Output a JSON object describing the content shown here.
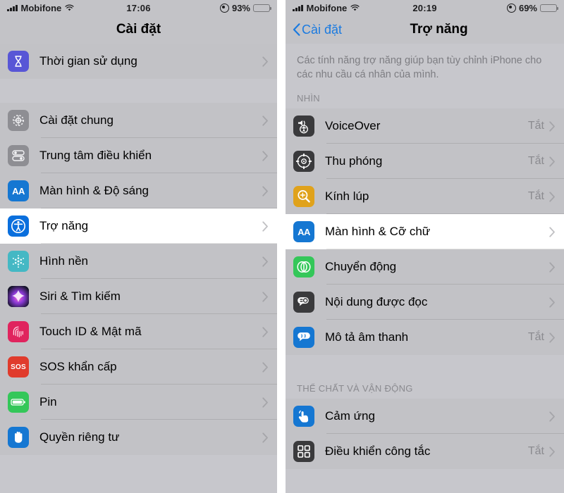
{
  "left_phone": {
    "status_bar": {
      "carrier": "Mobifone",
      "time": "17:06",
      "battery_pct": "93%",
      "battery_level": 93
    },
    "nav": {
      "title": "Cài đặt"
    },
    "groups": [
      {
        "rows": [
          {
            "label": "Thời gian sử dụng",
            "value": "",
            "icon": "hourglass-icon",
            "icon_color": "#5856d6",
            "selected": false
          }
        ]
      },
      {
        "rows": [
          {
            "label": "Cài đặt chung",
            "value": "",
            "icon": "gear-icon",
            "icon_color": "#8e8e93",
            "selected": false
          },
          {
            "label": "Trung tâm điều khiển",
            "value": "",
            "icon": "control-center-icon",
            "icon_color": "#8e8e93",
            "selected": false
          },
          {
            "label": "Màn hình & Độ sáng",
            "value": "",
            "icon": "display-brightness-icon",
            "icon_color": "#1577d2",
            "selected": false
          },
          {
            "label": "Trợ năng",
            "value": "",
            "icon": "accessibility-icon",
            "icon_color": "#0a6fdd",
            "selected": true
          },
          {
            "label": "Hình nền",
            "value": "",
            "icon": "wallpaper-icon",
            "icon_color": "#44b8c4",
            "selected": false
          },
          {
            "label": "Siri & Tìm kiếm",
            "value": "",
            "icon": "siri-icon",
            "icon_color": "#1c1c2e",
            "selected": false
          },
          {
            "label": "Touch ID & Mật mã",
            "value": "",
            "icon": "fingerprint-icon",
            "icon_color": "#e0245e",
            "selected": false
          },
          {
            "label": "SOS khẩn cấp",
            "value": "",
            "icon": "sos-icon",
            "icon_color": "#e03b2c",
            "selected": false
          },
          {
            "label": "Pin",
            "value": "",
            "icon": "battery-icon",
            "icon_color": "#34c759",
            "selected": false
          },
          {
            "label": "Quyền riêng tư",
            "value": "",
            "icon": "privacy-hand-icon",
            "icon_color": "#1577d2",
            "selected": false
          }
        ]
      }
    ]
  },
  "right_phone": {
    "status_bar": {
      "carrier": "Mobifone",
      "time": "20:19",
      "battery_pct": "69%",
      "battery_level": 69
    },
    "nav": {
      "back_label": "Cài đặt",
      "title": "Trợ năng"
    },
    "description": "Các tính năng trợ năng giúp bạn tùy chỉnh iPhone cho các nhu cầu cá nhân của mình.",
    "sections": [
      {
        "header": "NHÌN",
        "rows": [
          {
            "label": "VoiceOver",
            "value": "Tắt",
            "icon": "voiceover-icon",
            "icon_color": "#3a3a3c",
            "selected": false
          },
          {
            "label": "Thu phóng",
            "value": "Tắt",
            "icon": "zoom-icon",
            "icon_color": "#3a3a3c",
            "selected": false
          },
          {
            "label": "Kính lúp",
            "value": "Tắt",
            "icon": "magnifier-icon",
            "icon_color": "#e0a21b",
            "selected": false
          },
          {
            "label": "Màn hình & Cỡ chữ",
            "value": "",
            "icon": "display-text-size-icon",
            "icon_color": "#1577d2",
            "selected": true
          },
          {
            "label": "Chuyển động",
            "value": "",
            "icon": "motion-icon",
            "icon_color": "#34c759",
            "selected": false
          },
          {
            "label": "Nội dung được đọc",
            "value": "",
            "icon": "spoken-content-icon",
            "icon_color": "#3a3a3c",
            "selected": false
          },
          {
            "label": "Mô tả âm thanh",
            "value": "Tắt",
            "icon": "audio-description-icon",
            "icon_color": "#1577d2",
            "selected": false
          }
        ]
      },
      {
        "header": "THỂ CHẤT VÀ VẬN ĐỘNG",
        "rows": [
          {
            "label": "Cảm ứng",
            "value": "",
            "icon": "touch-icon",
            "icon_color": "#1577d2",
            "selected": false
          },
          {
            "label": "Điều khiển công tắc",
            "value": "Tắt",
            "icon": "switch-control-icon",
            "icon_color": "#3a3a3c",
            "selected": false
          }
        ]
      }
    ]
  }
}
